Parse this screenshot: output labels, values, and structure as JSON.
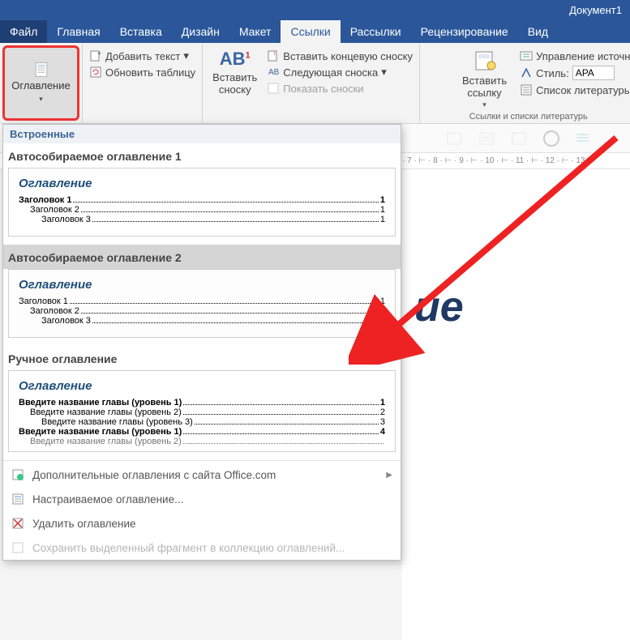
{
  "title": "Документ1",
  "tabs": {
    "file": "Файл",
    "home": "Главная",
    "insert": "Вставка",
    "design": "Дизайн",
    "layout": "Макет",
    "references": "Ссылки",
    "mailings": "Рассылки",
    "review": "Рецензирование",
    "view": "Вид"
  },
  "ribbon": {
    "tocBtn": "Оглавление",
    "addText": "Добавить текст",
    "updateTable": "Обновить таблицу",
    "insertFootnote": "Вставить\nсноску",
    "ab": "AB",
    "insertEndnote": "Вставить концевую сноску",
    "nextFootnote": "Следующая сноска",
    "showNotes": "Показать сноски",
    "insertLink": "Вставить\nссылку",
    "manageSources": "Управление источн",
    "styleLabel": "Стиль:",
    "styleValue": "APA",
    "bibliography": "Список литературь",
    "groupLabel": "Ссылки и списки литературь"
  },
  "ruler_text": "· 7 · ⊢ · 8 · ⊢ · 9 · ⊢ · 10 · ⊢ · 11 · ⊢ · 12 · ⊢ · 13 ·",
  "docVisible": "ие",
  "gallery": {
    "sectionBuiltin": "Встроенные",
    "cat1": "Автособираемое оглавление 1",
    "cat2": "Автособираемое оглавление 2",
    "cat3": "Ручное оглавление",
    "previewTitle": "Оглавление",
    "auto": {
      "h1": "Заголовок 1",
      "h2": "Заголовок 2",
      "h3": "Заголовок 3",
      "pg": "1"
    },
    "manual": {
      "l1": "Введите название главы (уровень 1)",
      "l2": "Введите название главы (уровень 2)",
      "l3": "Введите название главы (уровень 3)",
      "pg1": "1",
      "pg2": "2",
      "pg3": "3",
      "pg4": "4"
    },
    "menuMore": "Дополнительные оглавления с сайта Office.com",
    "menuCustom": "Настраиваемое оглавление...",
    "menuRemove": "Удалить оглавление",
    "menuSave": "Сохранить выделенный фрагмент в коллекцию оглавлений..."
  }
}
